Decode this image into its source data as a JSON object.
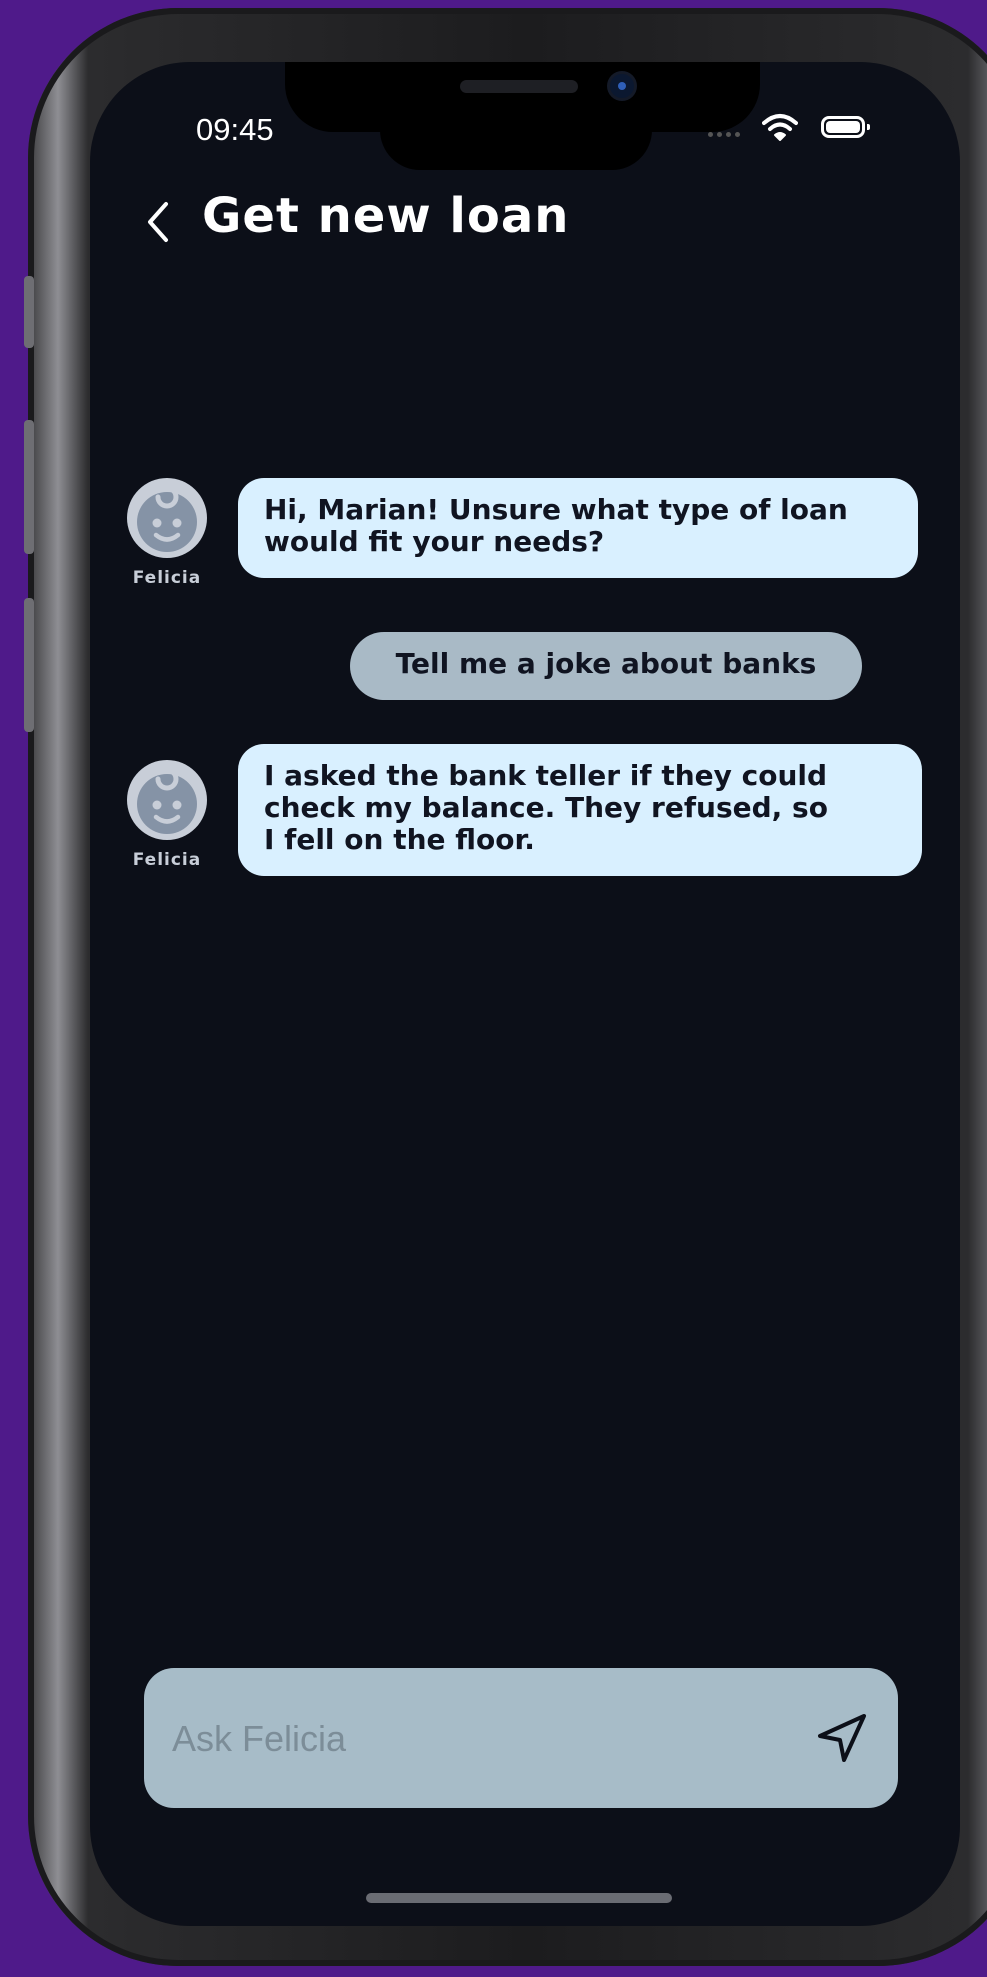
{
  "status_bar": {
    "time": "09:45"
  },
  "header": {
    "title": "Get new loan"
  },
  "messages": [
    {
      "sender": "Felicia",
      "text_lines": [
        "Hi, Marian! Unsure what type of loan",
        "would fit your needs?"
      ]
    },
    {
      "sender": "user",
      "text": "Tell me a joke about banks"
    },
    {
      "sender": "Felicia",
      "text_lines": [
        "I asked the bank teller if they could",
        "check my balance. They refused, so",
        "I fell on the floor."
      ]
    }
  ],
  "input": {
    "placeholder": "Ask Felicia"
  },
  "icons": {
    "back": "chevron-left-icon",
    "send": "send-icon",
    "avatar": "baby-face-icon"
  },
  "colors": {
    "background": "#4f1a8a",
    "screen": "#0c0f18",
    "bot_bubble": "#d9f0ff",
    "user_bubble": "#a9bac6",
    "input_bar": "#a7bcc8"
  }
}
